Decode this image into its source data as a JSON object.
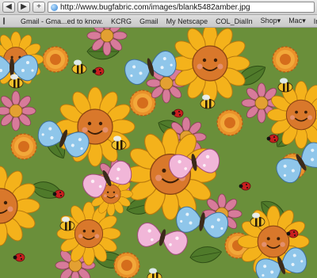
{
  "toolbar": {
    "back_glyph": "◀",
    "forward_glyph": "▶",
    "new_tab_glyph": "+",
    "url": "http://www.bugfabric.com/images/blank5482amber.jpg"
  },
  "bookmarks": {
    "items": [
      {
        "label": "Gmail - Gma...ed to know."
      },
      {
        "label": "KCRG"
      },
      {
        "label": "Gmail"
      },
      {
        "label": "My Netscape"
      },
      {
        "label": "COL_DialIn"
      },
      {
        "label": "Shop▾"
      },
      {
        "label": "Mac▾"
      },
      {
        "label": "In"
      }
    ]
  },
  "content": {
    "image_name": "fabric-print-image",
    "colors": {
      "leaf": "#4f7a2a",
      "sunflower_petal": "#f4b21b",
      "sunflower_face": "#d9782b",
      "daisy_pink": "#d77b9a",
      "butterfly_blue": "#8fc6ea",
      "butterfly_pink": "#f1b6d8",
      "ladybug": "#c81f1f"
    }
  }
}
